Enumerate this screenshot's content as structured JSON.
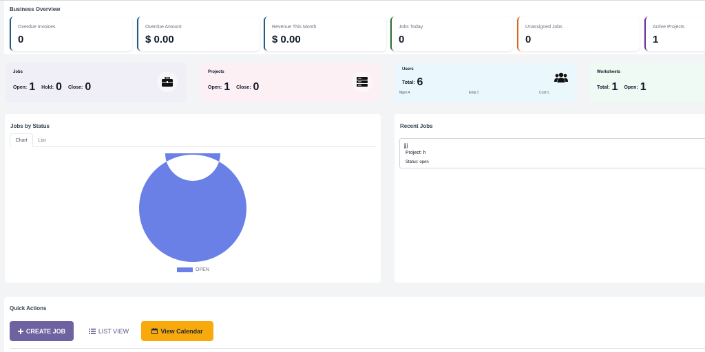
{
  "overview": {
    "title": "Business Overview",
    "stats": [
      {
        "label": "Overdue Invoices",
        "value": "0",
        "color": "#1e5b8a"
      },
      {
        "label": "Overdue Amount",
        "value": "$ 0.00",
        "color": "#1e5b8a"
      },
      {
        "label": "Revenue This Month",
        "value": "$ 0.00",
        "color": "#1e5b8a"
      },
      {
        "label": "Jobs Today",
        "value": "0",
        "color": "#2d6a2e"
      },
      {
        "label": "Unassigned Jobs",
        "value": "0",
        "color": "#d9641e"
      },
      {
        "label": "Active Projects",
        "value": "1",
        "color": "#6d2a9e"
      }
    ]
  },
  "summary": {
    "jobs": {
      "title": "Jobs",
      "open_label": "Open:",
      "open": "1",
      "hold_label": "Hold:",
      "hold": "0",
      "close_label": "Close:",
      "close": "0",
      "icon": "briefcase-icon"
    },
    "projects": {
      "title": "Projects",
      "open_label": "Open:",
      "open": "1",
      "close_label": "Close:",
      "close": "0",
      "icon": "server-icon"
    },
    "users": {
      "title": "Users",
      "total_label": "Total:",
      "total": "6",
      "mgrs": "Mgrs:4",
      "emp": "Emp:1",
      "cust": "Cust:1",
      "icon": "users-icon"
    },
    "worksheets": {
      "title": "Worksheets",
      "total_label": "Total:",
      "total": "1",
      "open_label": "Open:",
      "open": "1"
    }
  },
  "jobs_by_status": {
    "title": "Jobs by Status",
    "tabs": [
      "Chart",
      "List"
    ],
    "active_tab": "Chart"
  },
  "chart_data": {
    "type": "pie",
    "title": "",
    "labels": [
      "OPEN"
    ],
    "values": [
      1
    ],
    "colors": [
      "#6a80e6"
    ],
    "donut": true,
    "legend": "bottom"
  },
  "recent_jobs": {
    "title": "Recent Jobs",
    "items": [
      {
        "name": "jjj",
        "project": "Project: h",
        "status": "Status: open"
      }
    ]
  },
  "quick_actions": {
    "title": "Quick Actions",
    "create_job": "CREATE JOB",
    "list_view": "LIST VIEW",
    "view_calendar": "View Calendar"
  }
}
